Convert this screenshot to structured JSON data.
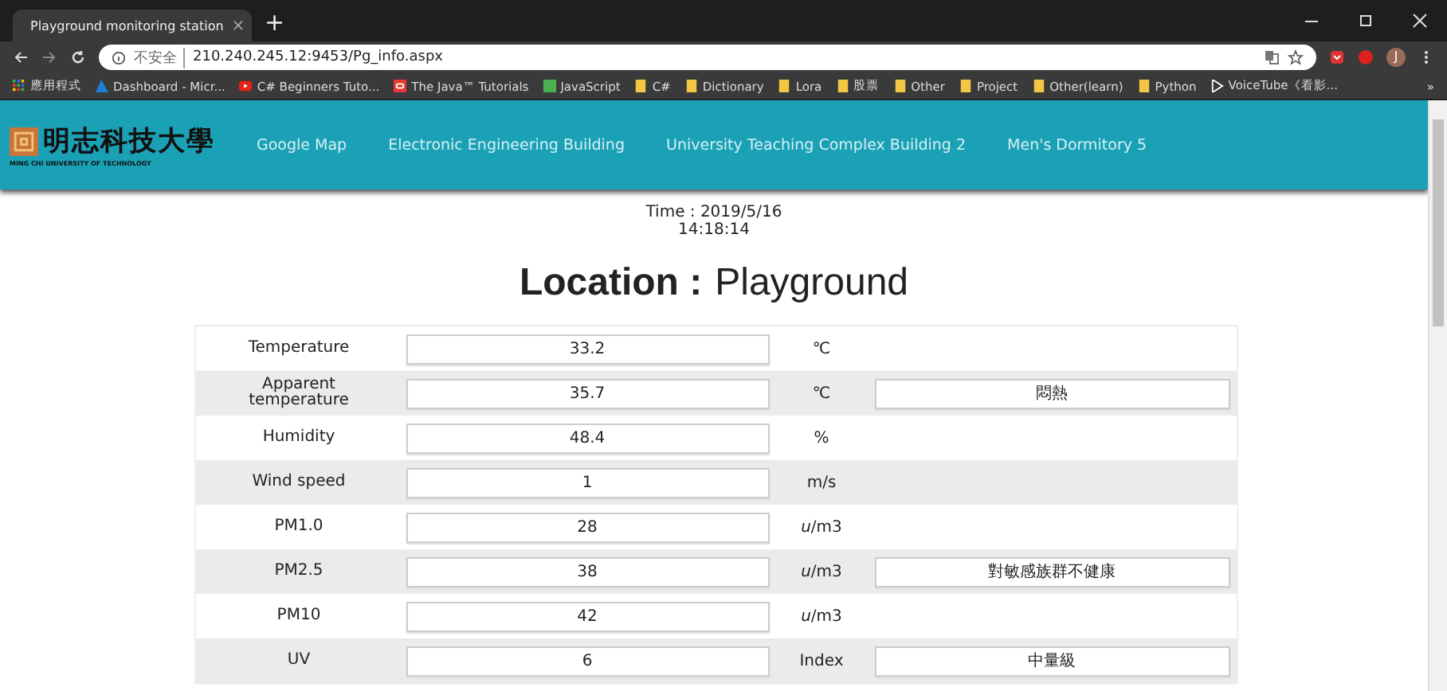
{
  "browser": {
    "tab": {
      "title": "Playground monitoring station",
      "close": "×"
    },
    "new_tab": "+",
    "address": {
      "security": "不安全",
      "url": "210.240.245.12:9453/Pg_info.aspx"
    },
    "bookmarks": [
      {
        "label": "應用程式",
        "kind": "apps"
      },
      {
        "label": "Dashboard - Micr...",
        "kind": "azure"
      },
      {
        "label": "C# Beginners Tuto...",
        "kind": "youtube"
      },
      {
        "label": "The Java™ Tutorials",
        "kind": "oracle"
      },
      {
        "label": "JavaScript",
        "kind": "w3"
      },
      {
        "label": "C#",
        "kind": "folder"
      },
      {
        "label": "Dictionary",
        "kind": "folder"
      },
      {
        "label": "Lora",
        "kind": "folder"
      },
      {
        "label": "股票",
        "kind": "folder"
      },
      {
        "label": "Other",
        "kind": "folder"
      },
      {
        "label": "Project",
        "kind": "folder"
      },
      {
        "label": "Other(learn)",
        "kind": "folder"
      },
      {
        "label": "Python",
        "kind": "folder"
      },
      {
        "label": "VoiceTube《看影...",
        "kind": "voicetube"
      }
    ],
    "more_bookmarks": "»",
    "profile": "J"
  },
  "navbar": {
    "logo": {
      "name": "明志科技大學",
      "subtitle": "MING CHI UNIVERSITY OF TECHNOLOGY"
    },
    "links": [
      "Google Map",
      "Electronic Engineering Building",
      "University Teaching Complex Building 2",
      "Men's Dormitory 5"
    ]
  },
  "time": {
    "date": "Time : 2019/5/16",
    "clock": "14:18:14"
  },
  "location": {
    "label": "Location :",
    "value": "Playground"
  },
  "readings": [
    {
      "name": "Temperature",
      "value": "33.2",
      "unit": "℃"
    },
    {
      "name": "Apparent temperature",
      "value": "35.7",
      "unit": "℃",
      "status": "悶熱"
    },
    {
      "name": "Humidity",
      "value": "48.4",
      "unit": "%"
    },
    {
      "name": "Wind speed",
      "value": "1",
      "unit": "m/s"
    },
    {
      "name": "PM1.0",
      "value": "28",
      "unit": "*u*/m3"
    },
    {
      "name": "PM2.5",
      "value": "38",
      "unit": "*u*/m3",
      "status": "對敏感族群不健康"
    },
    {
      "name": "PM10",
      "value": "42",
      "unit": "*u*/m3"
    },
    {
      "name": "UV",
      "value": "6",
      "unit": "Index",
      "status": "中量級"
    }
  ]
}
